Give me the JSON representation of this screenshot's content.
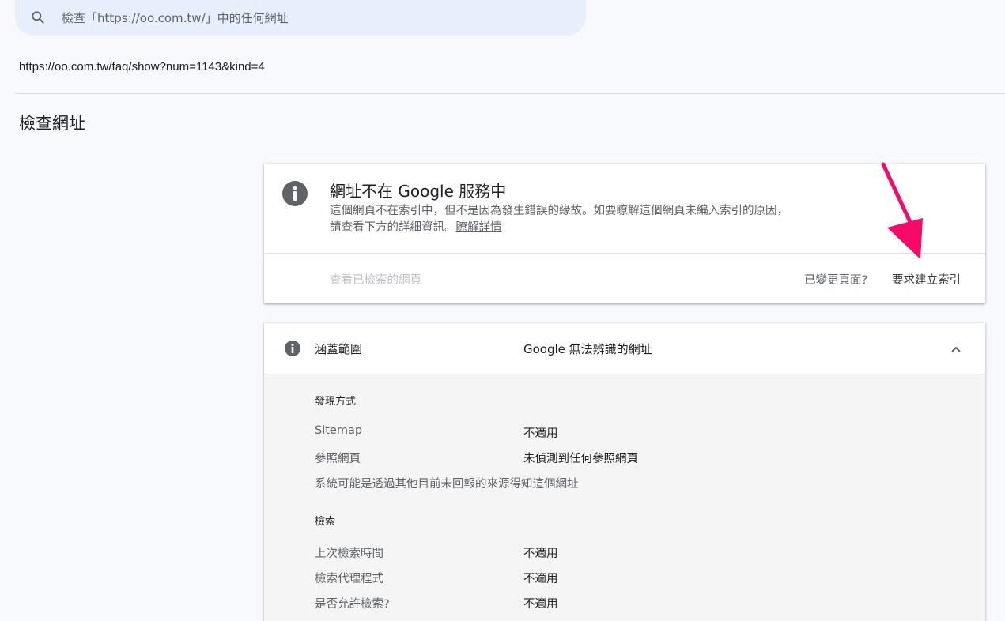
{
  "search": {
    "placeholder": "檢查「https://oo.com.tw/」中的任何網址"
  },
  "inspected_url": "https://oo.com.tw/faq/show?num=1143&kind=4",
  "page_title": "檢查網址",
  "status": {
    "title": "網址不在 Google 服務中",
    "description": "這個網頁不在索引中，但不是因為發生錯誤的緣故。如要瞭解這個網頁未編入索引的原因，請查看下方的詳細資訊。",
    "learn_more": "瞭解詳情",
    "view_crawled": "查看已檢索的網頁",
    "page_changed": "已變更頁面?",
    "request_indexing": "要求建立索引"
  },
  "coverage": {
    "label": "涵蓋範圍",
    "value": "Google 無法辨識的網址",
    "discovery": {
      "heading": "發現方式",
      "sitemap_label": "Sitemap",
      "sitemap_value": "不適用",
      "referring_label": "參照網頁",
      "referring_value": "未偵測到任何參照網頁",
      "note": "系統可能是透過其他目前未回報的來源得知這個網址"
    },
    "crawl": {
      "heading": "檢索",
      "last_crawl_label": "上次檢索時間",
      "last_crawl_value": "不適用",
      "crawler_label": "檢索代理程式",
      "crawler_value": "不適用",
      "allowed_label": "是否允許檢索?",
      "allowed_value": "不適用"
    }
  },
  "colors": {
    "annotation_arrow": "#f50a6a",
    "info_icon": "#5f6368"
  },
  "icons": {
    "search": "search-icon",
    "status": "info-icon",
    "coverage": "info-icon",
    "collapse": "chevron-up-icon"
  }
}
